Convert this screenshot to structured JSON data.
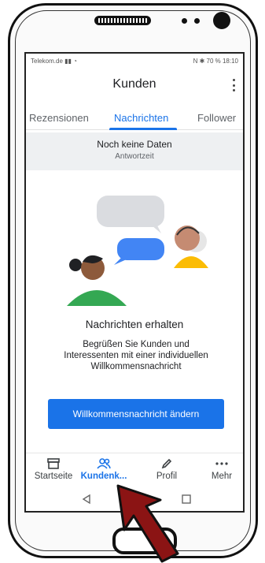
{
  "status_bar": {
    "carrier": "Telekom.de",
    "right": "N ✱ 70 % 18:10"
  },
  "app_bar": {
    "title": "Kunden",
    "more_icon": "more-vert-icon"
  },
  "tabs": [
    {
      "label": "Rezensionen",
      "active": false
    },
    {
      "label": "Nachrichten",
      "active": true
    },
    {
      "label": "Follower",
      "active": false
    }
  ],
  "stat": {
    "value": "Noch keine Daten",
    "label": "Antwortzeit"
  },
  "content": {
    "heading": "Nachrichten erhalten",
    "body": "Begrüßen Sie Kunden und Interessenten mit einer individuellen Willkommensnachricht",
    "cta_label": "Willkommensnachricht ändern"
  },
  "bottom_nav": [
    {
      "label": "Startseite",
      "icon": "storefront-icon",
      "active": false
    },
    {
      "label": "Kundenk...",
      "icon": "people-icon",
      "active": true
    },
    {
      "label": "Profil",
      "icon": "pencil-icon",
      "active": false
    },
    {
      "label": "Mehr",
      "icon": "more-horiz-icon",
      "active": false
    }
  ],
  "system_nav": {
    "back": "back-icon",
    "home": "home-icon",
    "recent": "recent-apps-icon"
  },
  "colors": {
    "accent": "#1a73e8",
    "stat_background": "#eef0f2",
    "arrow": "#8b1414"
  }
}
